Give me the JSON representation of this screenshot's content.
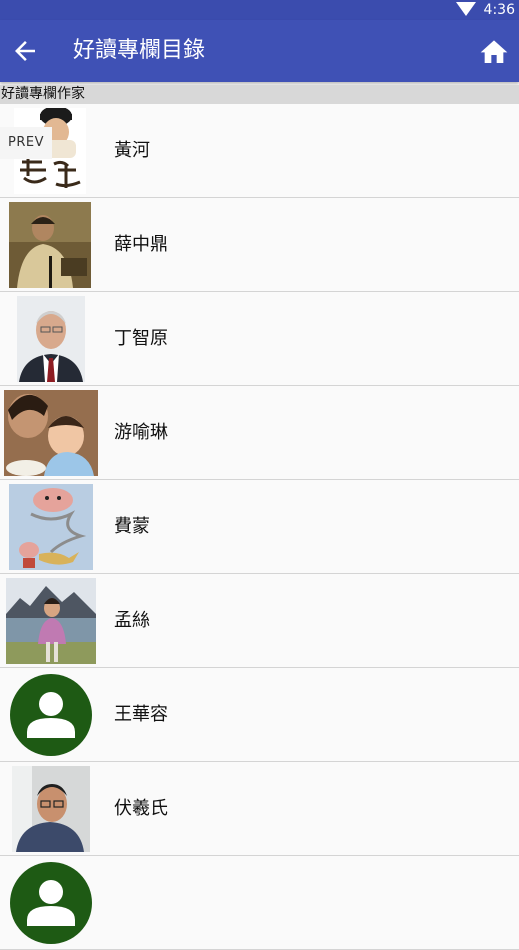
{
  "status_bar": {
    "time": "4:36"
  },
  "app_bar": {
    "title": "好讀專欄目錄"
  },
  "section_header": "好讀專欄作家",
  "prev_label": "PREV",
  "colors": {
    "app_bar": "#3f51b5",
    "status_bar": "#3b4cae",
    "avatar_placeholder": "#1e5a14"
  },
  "authors": [
    {
      "name": "黃河",
      "photo": "portrait-with-calligraphy"
    },
    {
      "name": "薛中鼎",
      "photo": "portrait-man-seated"
    },
    {
      "name": "丁智原",
      "photo": "portrait-man-suit"
    },
    {
      "name": "游喻琳",
      "photo": "photo-mother-child"
    },
    {
      "name": "費蒙",
      "photo": "illustration-genie-lamp"
    },
    {
      "name": "孟絲",
      "photo": "photo-woman-lake-mountains"
    },
    {
      "name": "王華容",
      "photo": "default-person-avatar"
    },
    {
      "name": "伏羲氏",
      "photo": "portrait-man-glasses"
    },
    {
      "name": "",
      "photo": "default-person-avatar"
    }
  ]
}
